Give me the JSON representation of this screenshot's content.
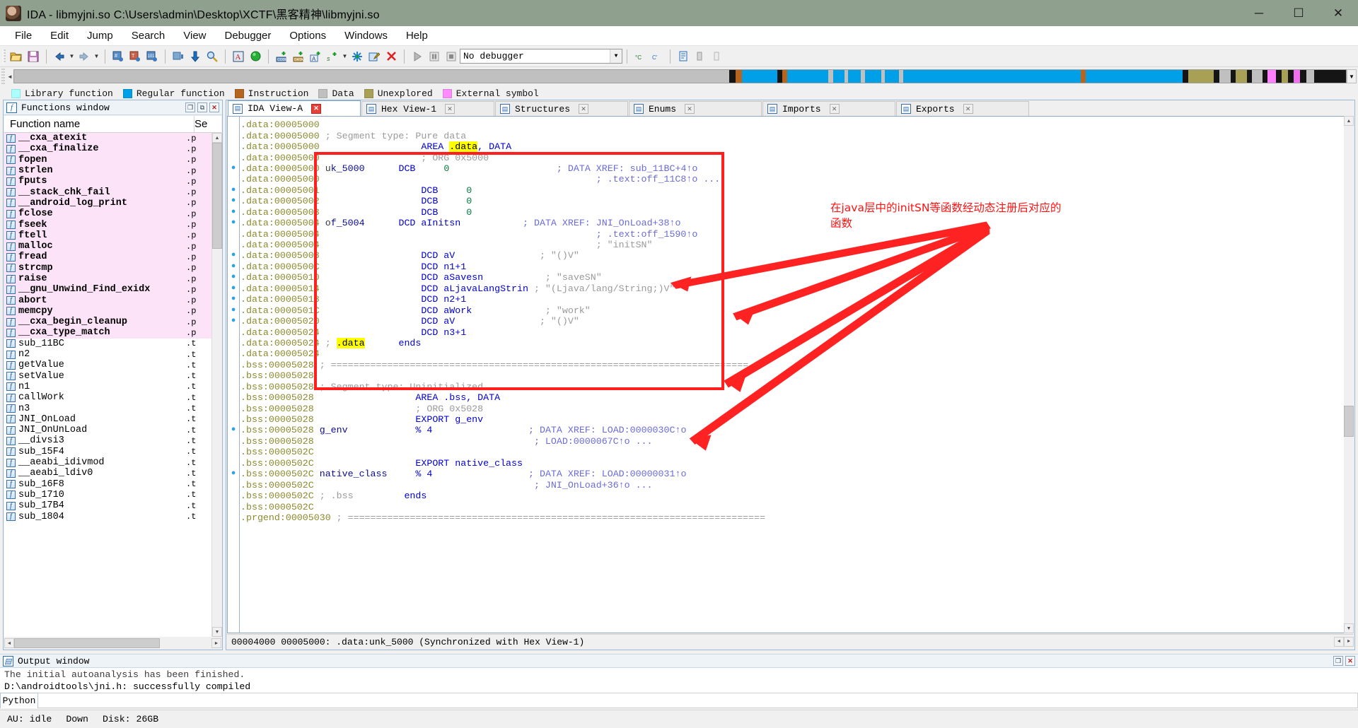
{
  "window": {
    "title": "IDA - libmyjni.so C:\\Users\\admin\\Desktop\\XCTF\\黑客精神\\libmyjni.so",
    "logo_icon": "ida-app-icon",
    "minimize": "─",
    "maximize": "☐",
    "close": "✕"
  },
  "menu": [
    "File",
    "Edit",
    "Jump",
    "Search",
    "View",
    "Debugger",
    "Options",
    "Windows",
    "Help"
  ],
  "toolbar": {
    "debugger_value": "No debugger",
    "icons": [
      "open-file-icon",
      "save-icon",
      "back-arrow-icon",
      "back-dropdown-icon",
      "forward-arrow-icon",
      "forward-dropdown-icon",
      "jump-to-address-icon",
      "jump-to-text-icon",
      "jump-to-number-icon",
      "jump-to-entry-icon",
      "down-arrow-icon",
      "search-icon",
      "alpha-warn-icon",
      "green-circle-icon",
      "make-code-icon",
      "make-data-icon",
      "make-ascii-icon",
      "make-struct-icon",
      "struct-dropdown-icon",
      "make-array-icon",
      "edit-function-icon",
      "undefine-icon",
      "run-icon",
      "pause-icon",
      "stop-icon",
      "step-into-icon",
      "step-over-icon",
      "list-icon",
      "trace-icon",
      "trace-alt-icon"
    ]
  },
  "navband": {
    "segments": [
      {
        "color": "#c0c0c0",
        "width": 56.3
      },
      {
        "color": "#151515",
        "width": 0.5
      },
      {
        "color": "#b5651d",
        "width": 0.5
      },
      {
        "color": "#00a0e9",
        "width": 2.8
      },
      {
        "color": "#151515",
        "width": 0.4
      },
      {
        "color": "#b5651d",
        "width": 0.4
      },
      {
        "color": "#00a0e9",
        "width": 3.2
      },
      {
        "color": "#c0c0c0",
        "width": 0.4
      },
      {
        "color": "#00a0e9",
        "width": 0.9
      },
      {
        "color": "#c0c0c0",
        "width": 0.3
      },
      {
        "color": "#00a0e9",
        "width": 1.0
      },
      {
        "color": "#c0c0c0",
        "width": 0.3
      },
      {
        "color": "#00a0e9",
        "width": 1.3
      },
      {
        "color": "#c0c0c0",
        "width": 0.3
      },
      {
        "color": "#00a0e9",
        "width": 1.1
      },
      {
        "color": "#c0c0c0",
        "width": 0.3
      },
      {
        "color": "#00a0e9",
        "width": 14.0
      },
      {
        "color": "#b5651d",
        "width": 0.4
      },
      {
        "color": "#00a0e9",
        "width": 7.6
      },
      {
        "color": "#151515",
        "width": 0.5
      },
      {
        "color": "#a8a055",
        "width": 2.0
      },
      {
        "color": "#151515",
        "width": 0.4
      },
      {
        "color": "#c0c0c0",
        "width": 0.9
      },
      {
        "color": "#151515",
        "width": 0.4
      },
      {
        "color": "#a8a055",
        "width": 0.9
      },
      {
        "color": "#151515",
        "width": 0.4
      },
      {
        "color": "#c0c0c0",
        "width": 0.8
      },
      {
        "color": "#151515",
        "width": 0.4
      },
      {
        "color": "#ff7fff",
        "width": 0.7
      },
      {
        "color": "#151515",
        "width": 0.4
      },
      {
        "color": "#a8a055",
        "width": 0.5
      },
      {
        "color": "#151515",
        "width": 0.5
      },
      {
        "color": "#f070f0",
        "width": 0.5
      },
      {
        "color": "#151515",
        "width": 0.5
      },
      {
        "color": "#c0c0c0",
        "width": 0.6
      },
      {
        "color": "#151515",
        "width": 2.5
      }
    ]
  },
  "legend": [
    {
      "label": "Library function",
      "color": "#aaffff"
    },
    {
      "label": "Regular function",
      "color": "#00a0e9"
    },
    {
      "label": "Instruction",
      "color": "#b5651d"
    },
    {
      "label": "Data",
      "color": "#c0c0c0"
    },
    {
      "label": "Unexplored",
      "color": "#a8a055"
    },
    {
      "label": "External symbol",
      "color": "#ff8cff"
    }
  ],
  "functions_window": {
    "title": "Functions window",
    "title_icon": "functions-window-icon",
    "columns": [
      "Function name",
      "Se"
    ],
    "rows": [
      {
        "name": "__cxa_atexit",
        "seg": ".p",
        "lib": true
      },
      {
        "name": "__cxa_finalize",
        "seg": ".p",
        "lib": true
      },
      {
        "name": "fopen",
        "seg": ".p",
        "lib": true
      },
      {
        "name": "strlen",
        "seg": ".p",
        "lib": true
      },
      {
        "name": "fputs",
        "seg": ".p",
        "lib": true
      },
      {
        "name": "__stack_chk_fail",
        "seg": ".p",
        "lib": true
      },
      {
        "name": "__android_log_print",
        "seg": ".p",
        "lib": true
      },
      {
        "name": "fclose",
        "seg": ".p",
        "lib": true
      },
      {
        "name": "fseek",
        "seg": ".p",
        "lib": true
      },
      {
        "name": "ftell",
        "seg": ".p",
        "lib": true
      },
      {
        "name": "malloc",
        "seg": ".p",
        "lib": true
      },
      {
        "name": "fread",
        "seg": ".p",
        "lib": true
      },
      {
        "name": "strcmp",
        "seg": ".p",
        "lib": true
      },
      {
        "name": "raise",
        "seg": ".p",
        "lib": true
      },
      {
        "name": "__gnu_Unwind_Find_exidx",
        "seg": ".p",
        "lib": true
      },
      {
        "name": "abort",
        "seg": ".p",
        "lib": true
      },
      {
        "name": "memcpy",
        "seg": ".p",
        "lib": true
      },
      {
        "name": "__cxa_begin_cleanup",
        "seg": ".p",
        "lib": true
      },
      {
        "name": "__cxa_type_match",
        "seg": ".p",
        "lib": true
      },
      {
        "name": "sub_11BC",
        "seg": ".t",
        "lib": false
      },
      {
        "name": "n2",
        "seg": ".t",
        "lib": false
      },
      {
        "name": "getValue",
        "seg": ".t",
        "lib": false
      },
      {
        "name": "setValue",
        "seg": ".t",
        "lib": false
      },
      {
        "name": "n1",
        "seg": ".t",
        "lib": false
      },
      {
        "name": "callWork",
        "seg": ".t",
        "lib": false
      },
      {
        "name": "n3",
        "seg": ".t",
        "lib": false
      },
      {
        "name": "JNI_OnLoad",
        "seg": ".t",
        "lib": false
      },
      {
        "name": "JNI_OnUnLoad",
        "seg": ".t",
        "lib": false
      },
      {
        "name": "__divsi3",
        "seg": ".t",
        "lib": false
      },
      {
        "name": "sub_15F4",
        "seg": ".t",
        "lib": false
      },
      {
        "name": "__aeabi_idivmod",
        "seg": ".t",
        "lib": false
      },
      {
        "name": "__aeabi_ldiv0",
        "seg": ".t",
        "lib": false
      },
      {
        "name": "sub_16F8",
        "seg": ".t",
        "lib": false
      },
      {
        "name": "sub_1710",
        "seg": ".t",
        "lib": false
      },
      {
        "name": "sub_17B4",
        "seg": ".t",
        "lib": false
      },
      {
        "name": "sub_1804",
        "seg": ".t",
        "lib": false
      }
    ]
  },
  "tabs": [
    {
      "label": "IDA View-A",
      "icon": "ida-view-icon",
      "active": true,
      "close": "✕"
    },
    {
      "label": "Hex View-1",
      "icon": "hex-view-icon",
      "active": false,
      "close": "✕"
    },
    {
      "label": "Structures",
      "icon": "structures-icon",
      "active": false,
      "close": "✕"
    },
    {
      "label": "Enums",
      "icon": "enums-icon",
      "active": false,
      "close": "✕"
    },
    {
      "label": "Imports",
      "icon": "imports-icon",
      "active": false,
      "close": "✕"
    },
    {
      "label": "Exports",
      "icon": "exports-icon",
      "active": false,
      "close": "✕"
    }
  ],
  "disassembly": {
    "lines": [
      {
        "dot": false,
        "addr": ".data:00005000",
        "parts": []
      },
      {
        "dot": false,
        "addr": ".data:00005000",
        "parts": [
          {
            "t": "; Segment type: Pure data",
            "c": "cmt",
            "pad": 1
          }
        ]
      },
      {
        "dot": false,
        "addr": ".data:00005000",
        "parts": [
          {
            "t": "AREA ",
            "c": "kw",
            "pad": 18
          },
          {
            "t": ".data",
            "c": "hl"
          },
          {
            "t": ", DATA",
            "c": "kw"
          }
        ]
      },
      {
        "dot": false,
        "addr": ".data:00005000",
        "parts": [
          {
            "t": "; ORG 0x5000",
            "c": "cmt",
            "pad": 18
          }
        ]
      },
      {
        "dot": true,
        "addr": ".data:00005000",
        "parts": [
          {
            "t": "u",
            "c": "nmo",
            "pad": 1
          },
          {
            "t": "k_5000",
            "c": "nm"
          },
          {
            "t": "DCB",
            "c": "mn",
            "pad": 6
          },
          {
            "t": "0",
            "c": "num",
            "pad": 5
          },
          {
            "t": "; DATA XREF: sub_11BC+4↑o",
            "c": "xref",
            "pad": 19
          }
        ]
      },
      {
        "dot": false,
        "addr": ".data:00005000",
        "parts": [
          {
            "t": "; .text:off_11C8↑o ...",
            "c": "xref",
            "pad": 49
          }
        ]
      },
      {
        "dot": true,
        "addr": ".data:00005001",
        "parts": [
          {
            "t": "DCB",
            "c": "mn",
            "pad": 18
          },
          {
            "t": "0",
            "c": "num",
            "pad": 5
          }
        ]
      },
      {
        "dot": true,
        "addr": ".data:00005002",
        "parts": [
          {
            "t": "DCB",
            "c": "mn",
            "pad": 18
          },
          {
            "t": "0",
            "c": "num",
            "pad": 5
          }
        ]
      },
      {
        "dot": true,
        "addr": ".data:00005003",
        "parts": [
          {
            "t": "DCB",
            "c": "mn",
            "pad": 18
          },
          {
            "t": "0",
            "c": "num",
            "pad": 5
          }
        ]
      },
      {
        "dot": true,
        "addr": ".data:00005004",
        "parts": [
          {
            "t": "o",
            "c": "nmo",
            "pad": 1
          },
          {
            "t": "f_5004",
            "c": "nm"
          },
          {
            "t": "DCD aInitsn",
            "c": "mn",
            "pad": 6
          },
          {
            "t": "; DATA XREF: JNI_OnLoad+38↑o",
            "c": "xref",
            "pad": 11
          }
        ]
      },
      {
        "dot": false,
        "addr": ".data:00005004",
        "parts": [
          {
            "t": "; .text:off_1590↑o",
            "c": "xref",
            "pad": 49
          }
        ]
      },
      {
        "dot": false,
        "addr": ".data:00005004",
        "parts": [
          {
            "t": "; \"initSN\"",
            "c": "cmt",
            "pad": 49
          }
        ]
      },
      {
        "dot": true,
        "addr": ".data:00005008",
        "parts": [
          {
            "t": "DCD aV",
            "c": "mn",
            "pad": 18
          },
          {
            "t": "; \"()V\"",
            "c": "cmt",
            "pad": 15
          }
        ]
      },
      {
        "dot": true,
        "addr": ".data:0000500C",
        "parts": [
          {
            "t": "DCD n1+1",
            "c": "mn",
            "pad": 18
          }
        ]
      },
      {
        "dot": true,
        "addr": ".data:00005010",
        "parts": [
          {
            "t": "DCD aSavesn",
            "c": "mn",
            "pad": 18
          },
          {
            "t": "; \"saveSN\"",
            "c": "cmt",
            "pad": 11
          }
        ]
      },
      {
        "dot": true,
        "addr": ".data:00005014",
        "parts": [
          {
            "t": "DCD aLjavaLangStrin",
            "c": "mn",
            "pad": 18
          },
          {
            "t": "; \"(Ljava/lang/String;)V\"",
            "c": "cmt",
            "pad": 1
          }
        ]
      },
      {
        "dot": true,
        "addr": ".data:00005018",
        "parts": [
          {
            "t": "DCD n2+1",
            "c": "mn",
            "pad": 18
          }
        ]
      },
      {
        "dot": true,
        "addr": ".data:0000501C",
        "parts": [
          {
            "t": "DCD aWork",
            "c": "mn",
            "pad": 18
          },
          {
            "t": "; \"work\"",
            "c": "cmt",
            "pad": 13
          }
        ]
      },
      {
        "dot": true,
        "addr": ".data:00005020",
        "parts": [
          {
            "t": "DCD aV",
            "c": "mn",
            "pad": 18
          },
          {
            "t": "; \"()V\"",
            "c": "cmt",
            "pad": 15
          }
        ]
      },
      {
        "dot": false,
        "addr": ".data:00005024",
        "parts": [
          {
            "t": "DCD n3+1",
            "c": "mn",
            "pad": 18
          }
        ]
      },
      {
        "dot": false,
        "addr": ".data:00005024",
        "parts": [
          {
            "t": "; ",
            "c": "cmt",
            "pad": 1
          },
          {
            "t": ".data",
            "c": "hl"
          },
          {
            "t": "ends",
            "c": "mn",
            "pad": 6
          }
        ]
      },
      {
        "dot": false,
        "addr": ".data:00005024",
        "parts": []
      },
      {
        "dot": false,
        "addr": ".bss:00005028",
        "parts": [
          {
            "t": "; ==========================================================================",
            "c": "cmt",
            "pad": 1
          }
        ]
      },
      {
        "dot": false,
        "addr": ".bss:00005028",
        "parts": []
      },
      {
        "dot": false,
        "addr": ".bss:00005028",
        "parts": [
          {
            "t": "; Segment type: Uninitialized",
            "c": "cmt",
            "pad": 1
          }
        ]
      },
      {
        "dot": false,
        "addr": ".bss:00005028",
        "parts": [
          {
            "t": "AREA .bss, DATA",
            "c": "kw",
            "pad": 18
          }
        ]
      },
      {
        "dot": false,
        "addr": ".bss:00005028",
        "parts": [
          {
            "t": "; ORG 0x5028",
            "c": "cmt",
            "pad": 18
          }
        ]
      },
      {
        "dot": false,
        "addr": ".bss:00005028",
        "parts": [
          {
            "t": "EXPORT g_env",
            "c": "kw",
            "pad": 18
          }
        ]
      },
      {
        "dot": true,
        "addr": ".bss:00005028",
        "parts": [
          {
            "t": "g_env",
            "c": "nm",
            "pad": 1
          },
          {
            "t": "% 4",
            "c": "mn",
            "pad": 12
          },
          {
            "t": "; DATA XREF: LOAD:0000030C↑o",
            "c": "xref",
            "pad": 17
          }
        ]
      },
      {
        "dot": false,
        "addr": ".bss:00005028",
        "parts": [
          {
            "t": "; LOAD:0000067C↑o ...",
            "c": "xref",
            "pad": 39
          }
        ]
      },
      {
        "dot": false,
        "addr": ".bss:0000502C",
        "parts": []
      },
      {
        "dot": false,
        "addr": ".bss:0000502C",
        "parts": [
          {
            "t": "EXPORT native_class",
            "c": "kw",
            "pad": 18
          }
        ]
      },
      {
        "dot": true,
        "addr": ".bss:0000502C",
        "parts": [
          {
            "t": "native_class",
            "c": "nm",
            "pad": 1
          },
          {
            "t": "% 4",
            "c": "mn",
            "pad": 5
          },
          {
            "t": "; DATA XREF: LOAD:00000031↑o",
            "c": "xref",
            "pad": 17
          }
        ]
      },
      {
        "dot": false,
        "addr": ".bss:0000502C",
        "parts": [
          {
            "t": "; JNI_OnLoad+36↑o ...",
            "c": "xref",
            "pad": 39
          }
        ]
      },
      {
        "dot": false,
        "addr": ".bss:0000502C",
        "parts": [
          {
            "t": "; .bss",
            "c": "cmt",
            "pad": 1
          },
          {
            "t": "ends",
            "c": "mn",
            "pad": 9
          }
        ]
      },
      {
        "dot": false,
        "addr": ".bss:0000502C",
        "parts": []
      },
      {
        "dot": false,
        "addr": ".prgend:00005030",
        "parts": [
          {
            "t": "; ==========================================================================",
            "c": "cmt",
            "pad": 1
          }
        ]
      }
    ],
    "status": "00004000 00005000: .data:unk_5000 (Synchronized with Hex View-1)"
  },
  "annotation": {
    "text": "在java层中的initSN等函数经动态注册后对应的函数",
    "color": "#ff1212"
  },
  "output_window": {
    "title": "Output window",
    "title_icon": "output-window-icon",
    "lines": [
      "The initial autoanalysis has been finished.",
      "D:\\androidtools\\jni.h: successfully compiled"
    ],
    "cli_tab": "Python",
    "cli_value": ""
  },
  "statusbar": {
    "cells": [
      "AU: idle",
      "Down",
      "Disk: 26GB"
    ]
  }
}
